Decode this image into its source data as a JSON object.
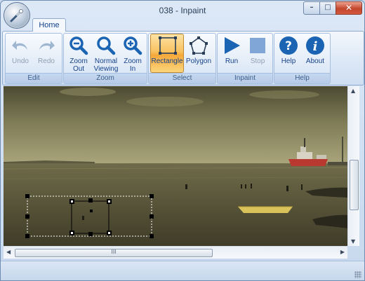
{
  "window": {
    "title": "038 - Inpaint"
  },
  "window_controls": {
    "minimize": "–",
    "maximize": "□",
    "close": "✕"
  },
  "ribbon": {
    "tabs": [
      {
        "label": "Home"
      }
    ],
    "groups": [
      {
        "label": "Edit",
        "buttons": [
          {
            "label": "Undo",
            "icon": "undo-arrow-icon",
            "enabled": false
          },
          {
            "label": "Redo",
            "icon": "redo-arrow-icon",
            "enabled": false
          }
        ]
      },
      {
        "label": "Zoom",
        "buttons": [
          {
            "label": "Zoom Out",
            "icon": "zoom-out-icon",
            "enabled": true
          },
          {
            "label": "Normal Viewing",
            "icon": "magnifier-icon",
            "enabled": true
          },
          {
            "label": "Zoom In",
            "icon": "zoom-in-icon",
            "enabled": true
          }
        ]
      },
      {
        "label": "Select",
        "buttons": [
          {
            "label": "Rectangle",
            "icon": "rectangle-select-icon",
            "enabled": true,
            "active": true
          },
          {
            "label": "Polygon",
            "icon": "polygon-select-icon",
            "enabled": true
          }
        ]
      },
      {
        "label": "Inpaint",
        "buttons": [
          {
            "label": "Run",
            "icon": "play-icon",
            "enabled": true
          },
          {
            "label": "Stop",
            "icon": "stop-icon",
            "enabled": false
          }
        ]
      },
      {
        "label": "Help",
        "buttons": [
          {
            "label": "Help",
            "icon": "question-icon",
            "enabled": true
          },
          {
            "label": "About",
            "icon": "info-icon",
            "enabled": true
          }
        ]
      }
    ]
  },
  "scrollbar": {
    "thumb_grip": "III"
  },
  "colors": {
    "accent": "#1b63b3",
    "active_button": "#f9c260",
    "window_frame": "#c7d8ee"
  }
}
